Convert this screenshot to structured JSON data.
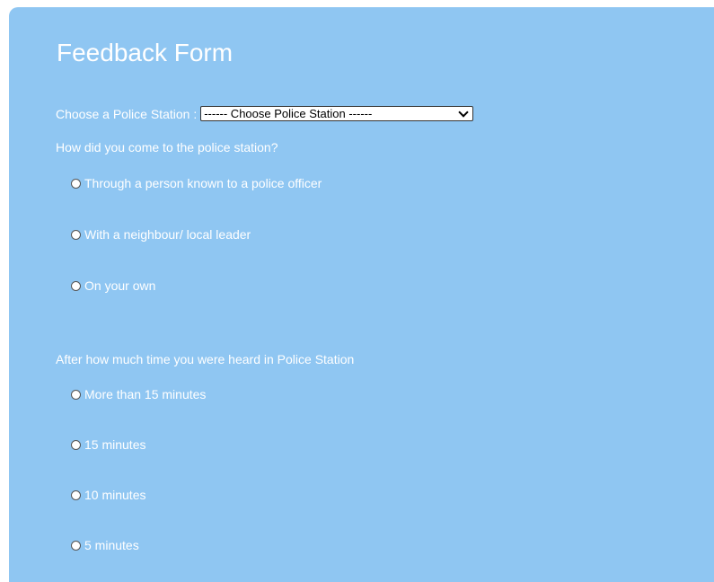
{
  "form": {
    "title": "Feedback Form",
    "station_label": "Choose a Police Station :",
    "station_select": {
      "selected": "------ Choose Police Station ------"
    },
    "q1": {
      "text": "How did you come to the police station?",
      "options": [
        "Through a person known to a police officer",
        "With a neighbour/ local leader",
        "On your own"
      ]
    },
    "q2": {
      "text": "After how much time you were heard in Police Station",
      "options": [
        "More than 15 minutes",
        "15 minutes",
        "10 minutes",
        "5 minutes"
      ]
    }
  },
  "colors": {
    "panel_bg": "#8fc6f2",
    "text": "#ffffff"
  },
  "icons": {
    "select": "chevron-down-icon",
    "radio": "radio-circle"
  }
}
